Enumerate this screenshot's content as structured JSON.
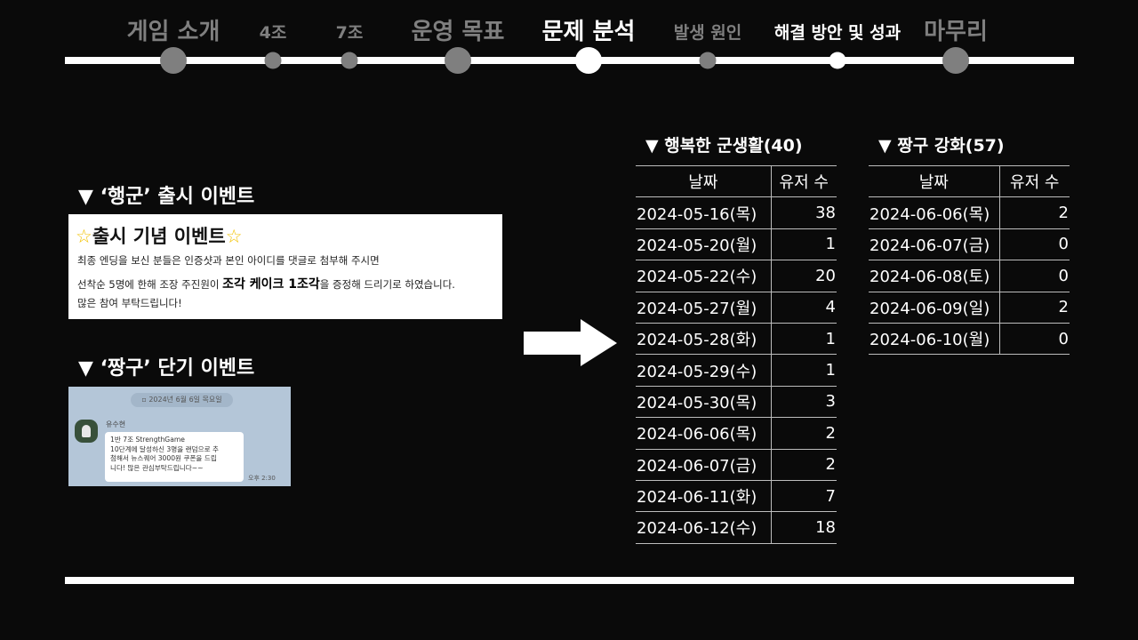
{
  "nav": {
    "items": [
      {
        "label": "게임 소개"
      },
      {
        "label": "4조"
      },
      {
        "label": "7조"
      },
      {
        "label": "운영 목표"
      },
      {
        "label": "문제 분석"
      },
      {
        "label": "발생 원인"
      },
      {
        "label": "해결 방안 및 성과"
      },
      {
        "label": "마무리"
      }
    ],
    "active": "문제 분석"
  },
  "left": {
    "heading1": "▼ ‘행군’ 출시 이벤트",
    "event_card": {
      "star": "☆",
      "title": "출시 기념 이벤트",
      "line1": "최종 엔딩을 보신 분들은 인증샷과 본인 아이디를 댓글로 첨부해 주시면",
      "line2_pre": "선착순 5명에 한해 조장 주진원이",
      "line2_bold": "조각 케이크 1조각",
      "line2_post": "을 증정해 드리기로 하였습니다.",
      "line3": "많은 참여 부탁드립니다!"
    },
    "heading2": "▼ ‘짱구’ 단기 이벤트",
    "chat": {
      "date": "2024년 6월 6일 목요일",
      "sender": "유수현",
      "lines": [
        "1반 7조 StrengthGame",
        "10단계에 달성하신 3명을 랜덤으로 추",
        "첨해서 뉴스퀘어 3000원 쿠폰을 드립",
        "니다! 많은 관심부탁드립니다~~"
      ],
      "time": "오후 2:30"
    }
  },
  "table1": {
    "title": "▼ 행복한 군생활(40)",
    "headers": [
      "날짜",
      "유저 수"
    ],
    "rows": [
      [
        "2024-05-16(목)",
        "38"
      ],
      [
        "2024-05-20(월)",
        "1"
      ],
      [
        "2024-05-22(수)",
        "20"
      ],
      [
        "2024-05-27(월)",
        "4"
      ],
      [
        "2024-05-28(화)",
        "1"
      ],
      [
        "2024-05-29(수)",
        "1"
      ],
      [
        "2024-05-30(목)",
        "3"
      ],
      [
        "2024-06-06(목)",
        "2"
      ],
      [
        "2024-06-07(금)",
        "2"
      ],
      [
        "2024-06-11(화)",
        "7"
      ],
      [
        "2024-06-12(수)",
        "18"
      ]
    ]
  },
  "table2": {
    "title": "▼ 짱구 강화(57)",
    "headers": [
      "날짜",
      "유저 수"
    ],
    "rows": [
      [
        "2024-06-06(목)",
        "2"
      ],
      [
        "2024-06-07(금)",
        "0"
      ],
      [
        "2024-06-08(토)",
        "0"
      ],
      [
        "2024-06-09(일)",
        "2"
      ],
      [
        "2024-06-10(월)",
        "0"
      ]
    ]
  },
  "colors": {
    "background": "#0a0a0a",
    "inactive_nav": "#7f7f7f",
    "active_nav": "#ffffff",
    "star": "#f2c200",
    "chat_background": "#b4c6d8"
  }
}
